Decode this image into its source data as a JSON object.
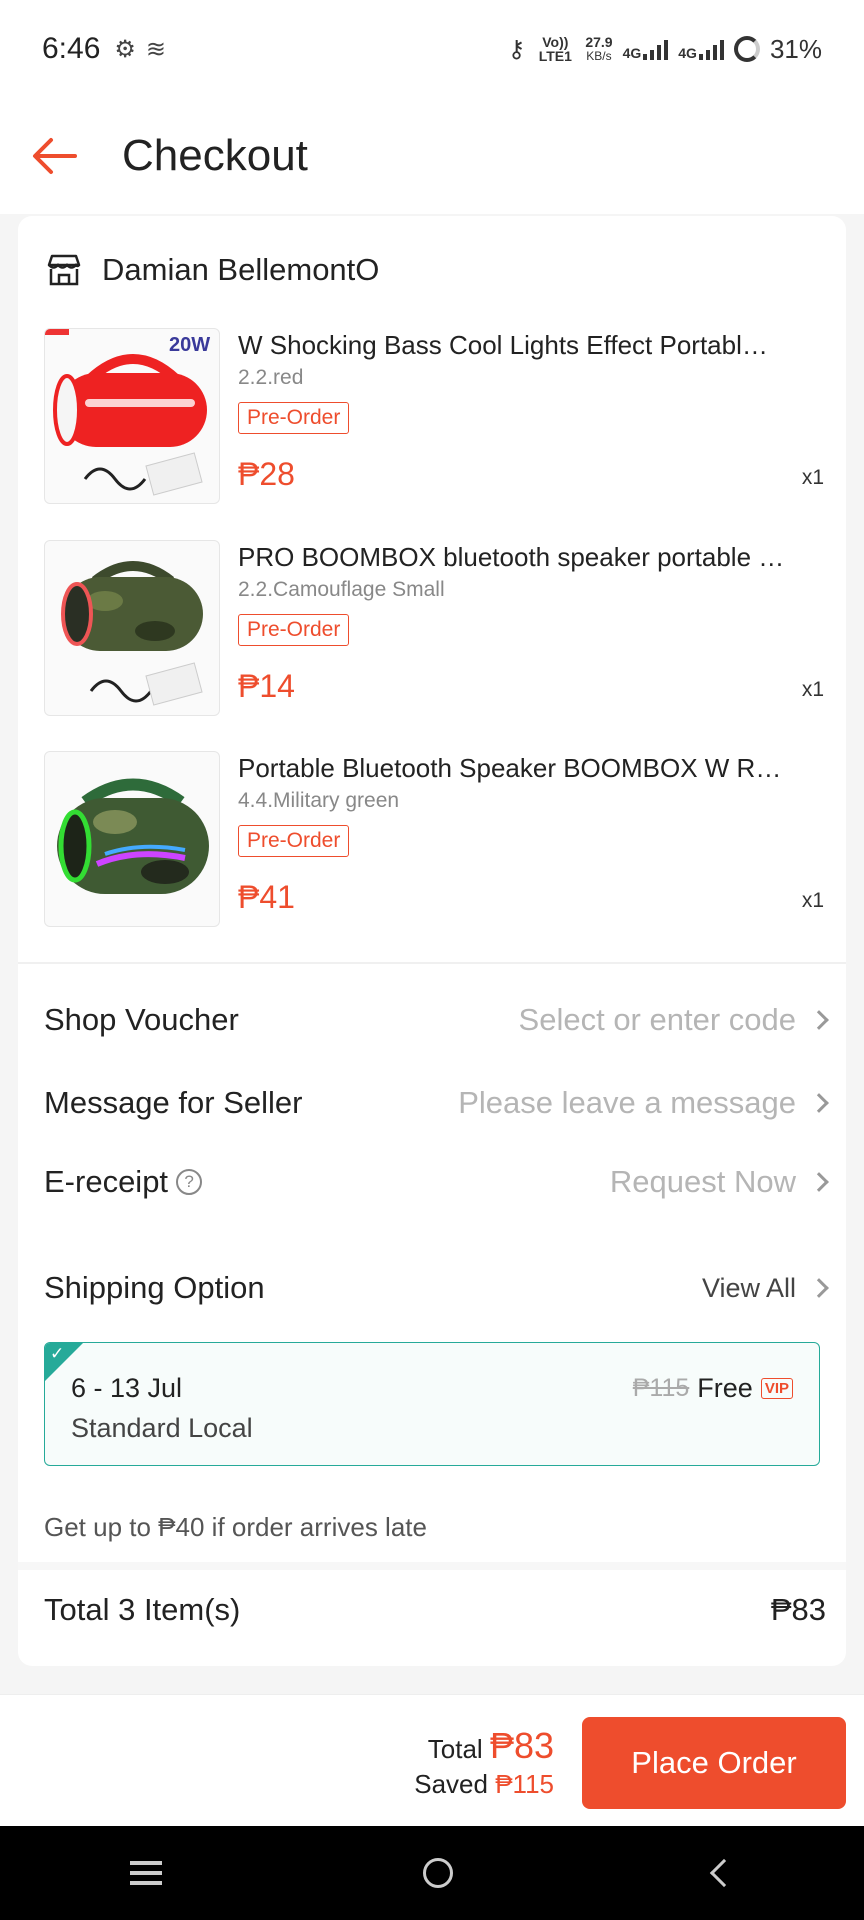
{
  "status": {
    "time": "6:46",
    "volte": "Vo)) LTE1",
    "speed_value": "27.9",
    "speed_unit": "KB/s",
    "net1": "4G",
    "net2": "4G",
    "battery": "31%"
  },
  "header": {
    "title": "Checkout"
  },
  "shop": {
    "name": "Damian BellemontO"
  },
  "items": [
    {
      "title": "W Shocking Bass Cool Lights Effect Portabl…",
      "variant": "2.2.red",
      "badge": "Pre-Order",
      "price": "₱28",
      "qty": "x1",
      "thumb_label": "20W"
    },
    {
      "title": "PRO BOOMBOX bluetooth speaker portable …",
      "variant": "2.2.Camouflage Small",
      "badge": "Pre-Order",
      "price": "₱14",
      "qty": "x1"
    },
    {
      "title": "Portable Bluetooth Speaker BOOMBOX W R…",
      "variant": "4.4.Military green",
      "badge": "Pre-Order",
      "price": "₱41",
      "qty": "x1"
    }
  ],
  "voucher": {
    "label": "Shop Voucher",
    "value": "Select or enter code"
  },
  "message": {
    "label": "Message for Seller",
    "value": "Please leave a message"
  },
  "ereceipt": {
    "label": "E-receipt",
    "help": "?",
    "value": "Request Now"
  },
  "shipping": {
    "label": "Shipping Option",
    "view_all": "View All",
    "date": "6 - 13 Jul",
    "method": "Standard Local",
    "old_price": "₱115",
    "price": "Free",
    "vip": "VIP",
    "late_note": "Get up to ₱40 if order arrives late"
  },
  "total": {
    "label": "Total 3 Item(s)",
    "value": "₱83"
  },
  "bottom": {
    "total_label": "Total",
    "total_value": "₱83",
    "saved_label": "Saved",
    "saved_value": "₱115",
    "place_order": "Place Order"
  },
  "colors": {
    "accent": "#ee4d2d",
    "teal": "#26aa99"
  }
}
